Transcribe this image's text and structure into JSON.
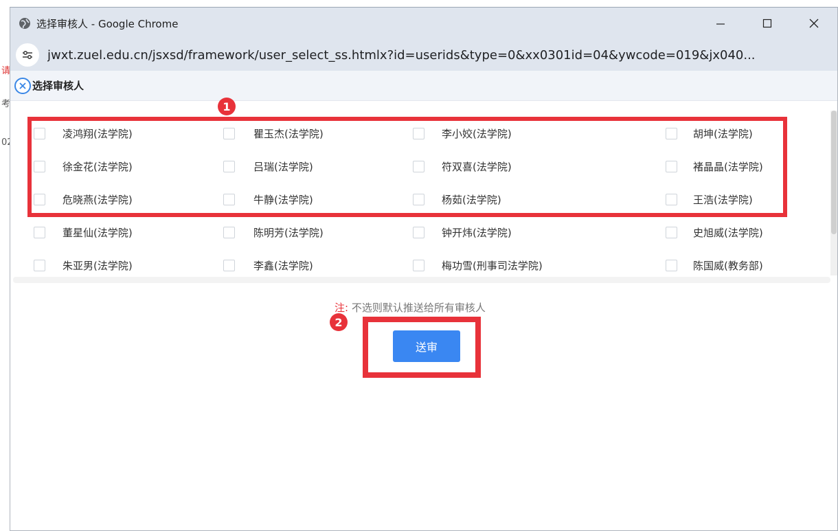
{
  "browser": {
    "title": "选择审核人 - Google Chrome",
    "url": "jwxt.zuel.edu.cn/jsxsd/framework/user_select_ss.htmlx?id=userids&type=0&xx0301id=04&ywcode=019&jx040..."
  },
  "background_page": {
    "fragments": [
      "请",
      "考",
      "02"
    ]
  },
  "dialog": {
    "title": "选择审核人",
    "reviewers": [
      [
        "凌鸿翔(法学院)",
        "瞿玉杰(法学院)",
        "李小姣(法学院)",
        "胡坤(法学院)"
      ],
      [
        "徐金花(法学院)",
        "吕瑞(法学院)",
        "符双喜(法学院)",
        "褚晶晶(法学院)"
      ],
      [
        "危晓燕(法学院)",
        "牛静(法学院)",
        "杨茹(法学院)",
        "王浩(法学院)"
      ],
      [
        "董星仙(法学院)",
        "陈明芳(法学院)",
        "钟开炜(法学院)",
        "史旭威(法学院)"
      ],
      [
        "朱亚男(法学院)",
        "李鑫(法学院)",
        "梅功雪(刑事司法学院)",
        "陈国威(教务部)"
      ]
    ],
    "note_label": "注:",
    "note_text": "不选则默认推送给所有审核人",
    "submit_label": "送审"
  },
  "annotations": {
    "marker1": "1",
    "marker2": "2",
    "highlight_color": "#e8323a"
  },
  "colors": {
    "accent": "#3a87f2",
    "titlebar": "#dfe5ee"
  }
}
